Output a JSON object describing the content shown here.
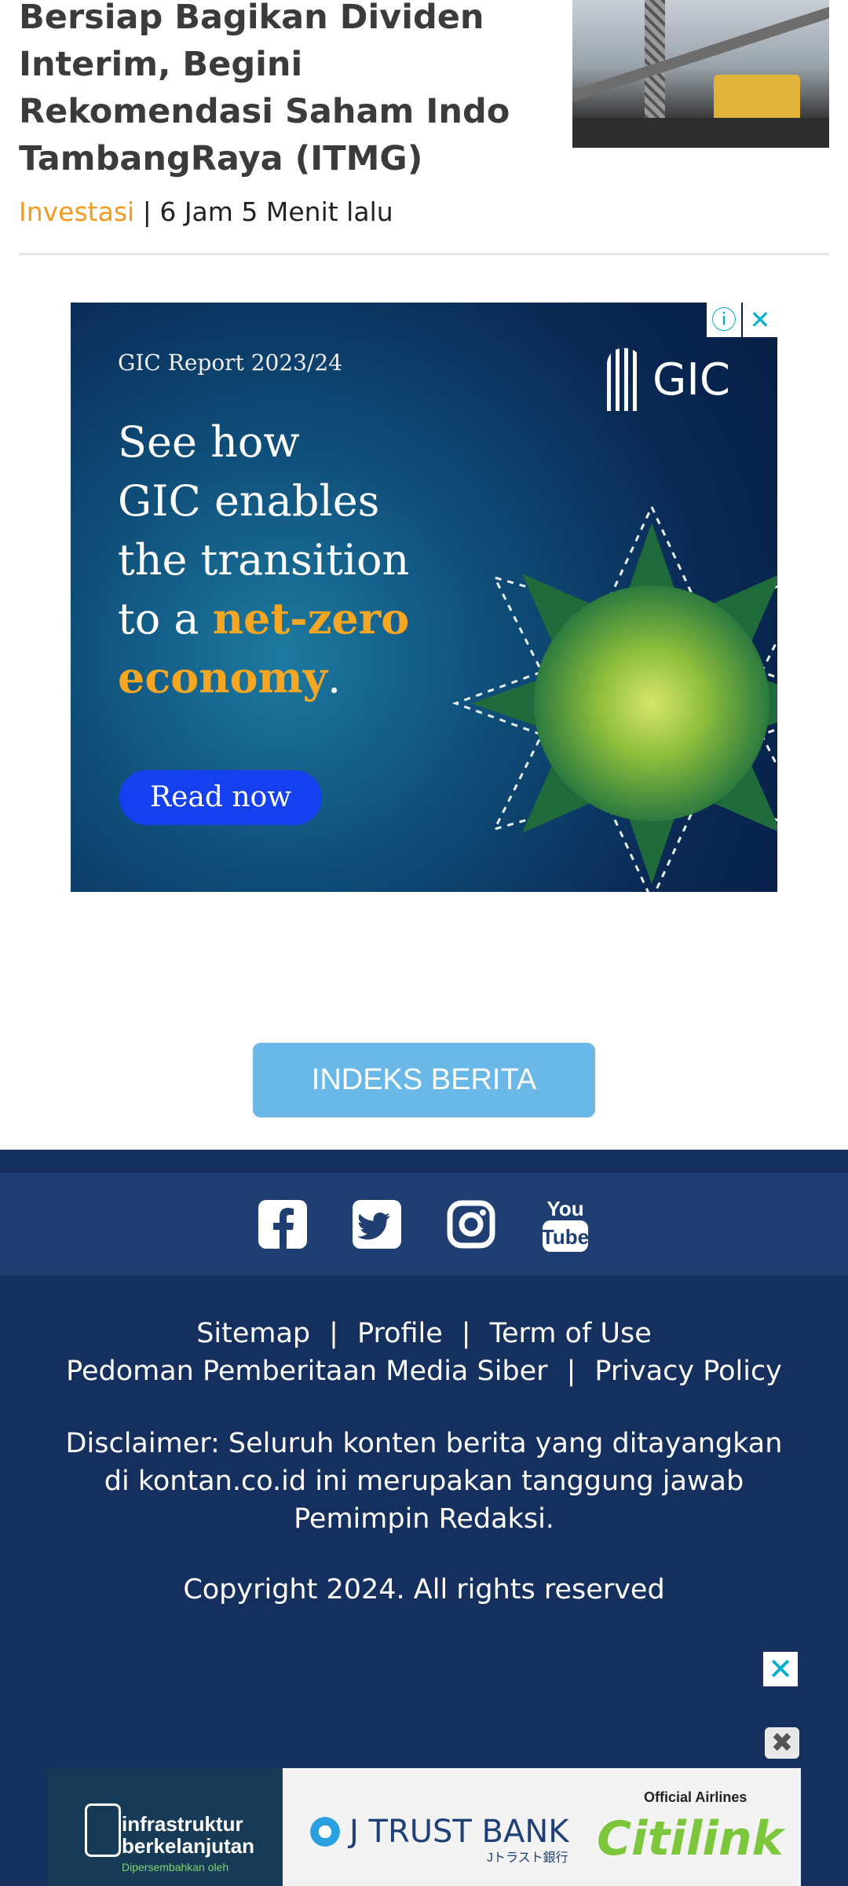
{
  "article": {
    "title": "Bersiap Bagikan Dividen Interim, Begini Rekomendasi Saham Indo TambangRaya (ITMG)",
    "category": "Investasi",
    "separator": "|",
    "time": "6 Jam 5 Menit lalu"
  },
  "ad": {
    "controls": {
      "info": "ⓘ",
      "close": "✕"
    },
    "report": "GIC Report 2023/24",
    "brand": "GIC",
    "headline_lines": [
      "See how",
      "GIC enables",
      "the transition",
      "to a "
    ],
    "headline_accent_1": "net-zero",
    "headline_accent_2": "economy",
    "headline_end": ".",
    "cta": "Read now",
    "colors": {
      "accent": "#f5a623",
      "cta": "#1540f0"
    }
  },
  "index_button": {
    "label": "INDEKS BERITA",
    "color": "#6ab8e7"
  },
  "footer": {
    "social_icons": [
      "facebook-icon",
      "twitter-icon",
      "instagram-icon",
      "youtube-icon"
    ],
    "links_row1": [
      "Sitemap",
      "Profile",
      "Term of Use"
    ],
    "links_row2": [
      "Pedoman Pemberitaan Media Siber",
      "Privacy Policy"
    ],
    "separator": "|",
    "disclaimer": "Disclaimer: Seluruh konten berita yang ditayangkan di kontan.co.id ini merupakan tanggung jawab Pemimpin Redaksi.",
    "copyright": "Copyright 2024. All rights reserved",
    "colors": {
      "background": "#15305e",
      "social_bar": "#1f3f72"
    }
  },
  "sticky_ad": {
    "close": "✕",
    "close2": "✖",
    "left_line1": "infrastruktur",
    "left_line2": "berkelanjutan",
    "left_line3": "Dipersembahkan oleh",
    "jtrust": "J TRUST BANK",
    "jtrust_sub": "Jトラスト銀行",
    "citilink_sub": "Official Airlines",
    "citilink": "Citilink"
  }
}
